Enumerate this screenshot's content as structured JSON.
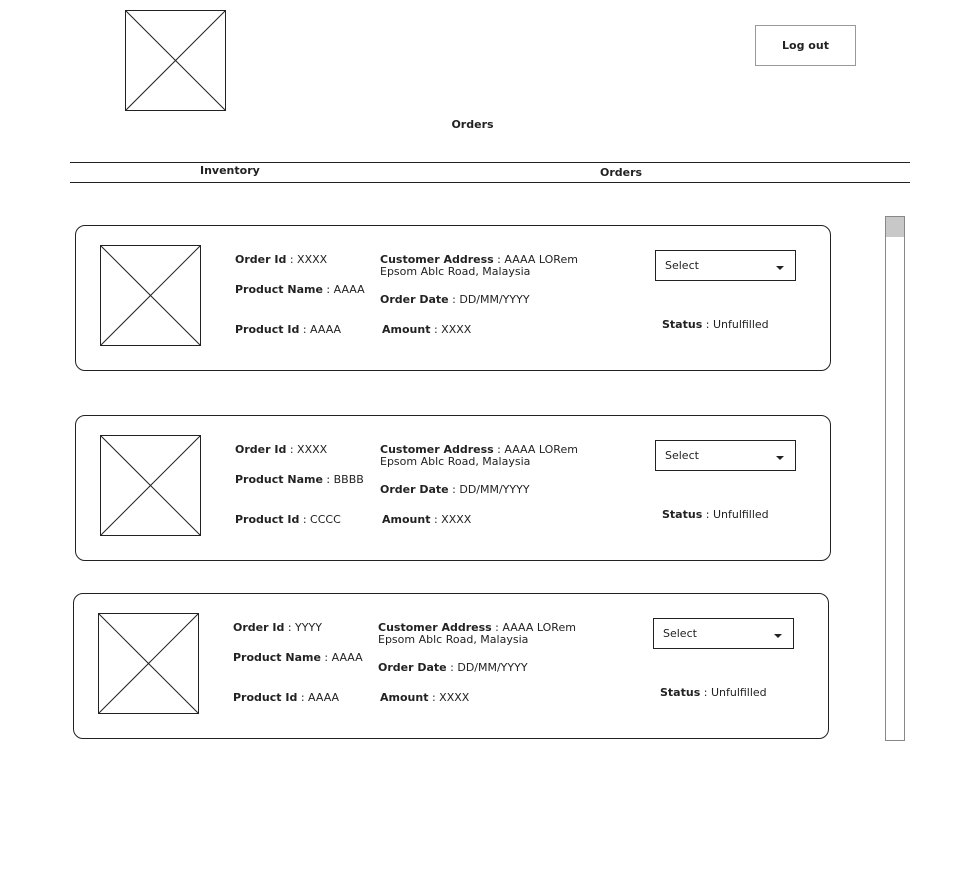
{
  "header": {
    "logout_label": "Log out",
    "page_title": "Orders"
  },
  "nav": {
    "tabs": [
      {
        "label": "Inventory"
      },
      {
        "label": "Orders"
      }
    ]
  },
  "labels": {
    "order_id": "Order Id",
    "product_name": "Product Name",
    "product_id": "Product Id",
    "customer_address": "Customer Address",
    "order_date": "Order Date",
    "amount": "Amount",
    "status": "Status",
    "sep": " : "
  },
  "orders": [
    {
      "order_id": "XXXX",
      "product_name": "AAAA",
      "product_id": "AAAA",
      "address_line1": "AAAA LORem",
      "address_line2": "Epsom Ablc Road, Malaysia",
      "order_date": "DD/MM/YYYY",
      "amount": "XXXX",
      "select": "Select",
      "status": "Unfulfilled"
    },
    {
      "order_id": "XXXX",
      "product_name": "BBBB",
      "product_id": "CCCC",
      "address_line1": "AAAA LORem",
      "address_line2": "Epsom Ablc Road, Malaysia",
      "order_date": "DD/MM/YYYY",
      "amount": "XXXX",
      "select": "Select",
      "status": "Unfulfilled"
    },
    {
      "order_id": "YYYY",
      "product_name": "AAAA",
      "product_id": "AAAA",
      "address_line1": "AAAA LORem",
      "address_line2": "Epsom Ablc Road, Malaysia",
      "order_date": "DD/MM/YYYY",
      "amount": "XXXX",
      "select": "Select",
      "status": "Unfulfilled"
    }
  ]
}
